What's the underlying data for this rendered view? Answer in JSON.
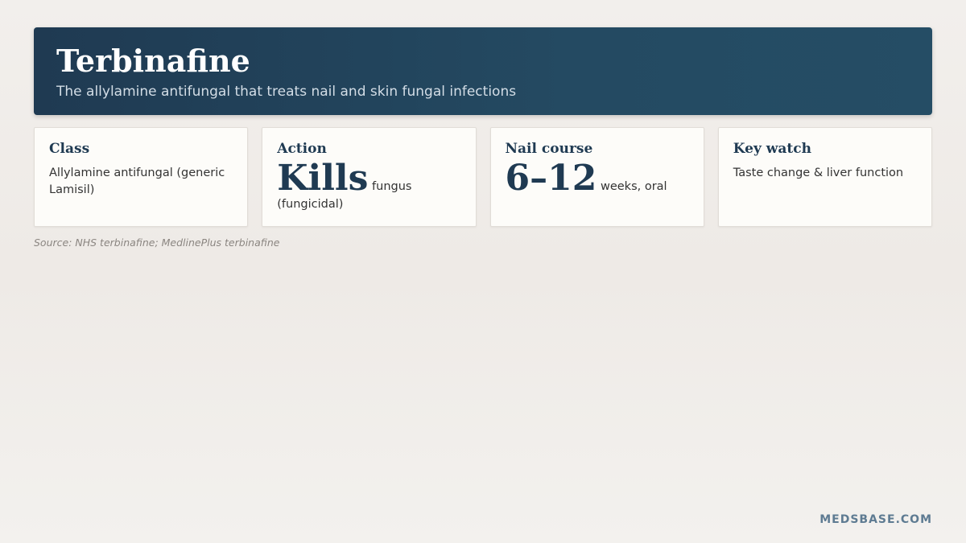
{
  "header": {
    "title": "Terbinafine",
    "subtitle": "The allylamine antifungal that treats nail and skin fungal infections"
  },
  "cards": [
    {
      "label": "Class",
      "text": "Allylamine antifungal (generic Lamisil)"
    },
    {
      "label": "Action",
      "big": "Kills",
      "rest": "fungus (fungicidal)"
    },
    {
      "label": "Nail course",
      "big": "6–12",
      "rest": "weeks, oral"
    },
    {
      "label": "Key watch",
      "text": "Taste change & liver function"
    }
  ],
  "source": "Source: NHS terbinafine; MedlinePlus terbinafine",
  "brand": "MEDSBASE.COM",
  "colors": {
    "header_bg": "#1f3a52",
    "accent_text": "#1f3a52",
    "card_bg": "#fdfcf9",
    "brand_text": "#5e7b92"
  }
}
